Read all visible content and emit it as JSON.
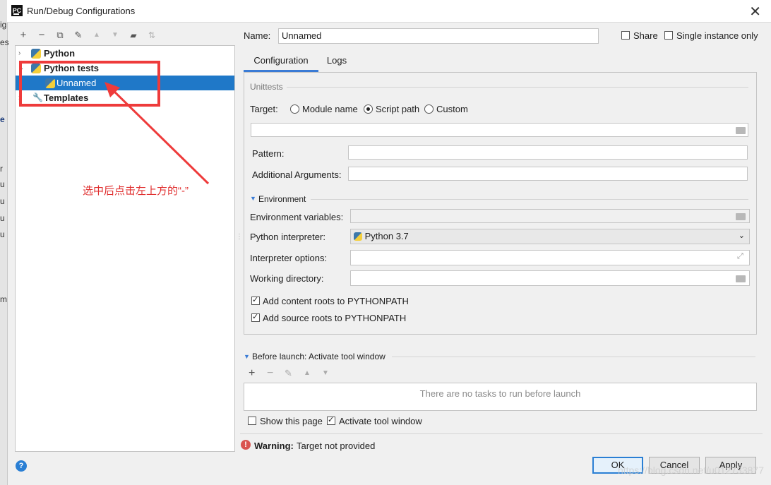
{
  "window": {
    "title": "Run/Debug Configurations",
    "logo": "PC"
  },
  "background_fragments": [
    "ig",
    "es",
    "e",
    "r",
    "u",
    "u",
    "u",
    "u",
    "m"
  ],
  "toolbar": {
    "items": [
      {
        "icon": "plus-icon",
        "glyph": "+"
      },
      {
        "icon": "minus-icon",
        "glyph": "−"
      },
      {
        "icon": "copy-icon",
        "glyph": "⧉"
      },
      {
        "icon": "wrench-icon",
        "glyph": "🔧"
      },
      {
        "icon": "arrow-up-icon",
        "glyph": "▲"
      },
      {
        "icon": "arrow-down-icon",
        "glyph": "▼"
      },
      {
        "icon": "folder-icon",
        "glyph": "▬"
      },
      {
        "icon": "sort-icon",
        "glyph": "⇅"
      }
    ]
  },
  "tree": {
    "nodes": [
      {
        "label": "Python",
        "bold": true,
        "expanded": false
      },
      {
        "label": "Python tests",
        "bold": true,
        "expanded": true
      },
      {
        "label": "Unnamed",
        "bold": false,
        "selected": true
      },
      {
        "label": "Templates",
        "bold": true,
        "expanded": false
      }
    ]
  },
  "annotation": {
    "text": "选中后点击左上方的“-”",
    "color": "#ee3b3b"
  },
  "header": {
    "name_label": "Name:",
    "name_value": "Unnamed",
    "share_label": "Share",
    "share_checked": false,
    "single_instance_label": "Single instance only",
    "single_instance_checked": false
  },
  "tabs": [
    {
      "label": "Configuration",
      "active": true
    },
    {
      "label": "Logs",
      "active": false
    }
  ],
  "config": {
    "section_title": "Unittests",
    "target_label": "Target:",
    "target_options": [
      {
        "label": "Module name",
        "selected": false
      },
      {
        "label": "Script path",
        "selected": true
      },
      {
        "label": "Custom",
        "selected": false
      }
    ],
    "script_path_value": "",
    "pattern_label": "Pattern:",
    "pattern_value": "",
    "additional_args_label": "Additional Arguments:",
    "additional_args_value": "",
    "environment_title": "Environment",
    "env_vars_label": "Environment variables:",
    "env_vars_value": "",
    "interpreter_label": "Python interpreter:",
    "interpreter_value": "Python 3.7",
    "interpreter_options_label": "Interpreter options:",
    "interpreter_options_value": "",
    "working_dir_label": "Working directory:",
    "working_dir_value": "",
    "add_content_roots_label": "Add content roots to PYTHONPATH",
    "add_content_roots_checked": true,
    "add_source_roots_label": "Add source roots to PYTHONPATH",
    "add_source_roots_checked": true
  },
  "before_launch": {
    "title": "Before launch: Activate tool window",
    "empty_text": "There are no tasks to run before launch",
    "show_page_label": "Show this page",
    "show_page_checked": false,
    "activate_tool_label": "Activate tool window",
    "activate_tool_checked": true
  },
  "warning": {
    "bold": "Warning:",
    "text": "Target not provided"
  },
  "buttons": {
    "ok": "OK",
    "cancel": "Cancel",
    "apply": "Apply"
  },
  "watermark": "https://blog.csdn.net/u012733877",
  "colors": {
    "selection": "#1f78c8",
    "accent": "#2a7fd4",
    "warning": "#d9534f"
  }
}
